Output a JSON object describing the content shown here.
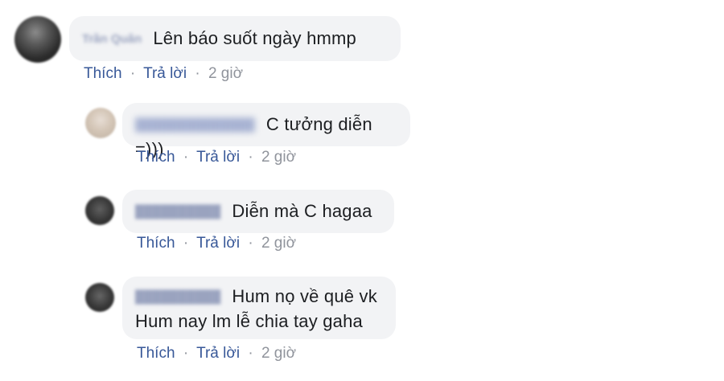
{
  "comments": [
    {
      "author": "Trần Quân",
      "text": "Lên báo suốt ngày hmmp",
      "like": "Thích",
      "reply": "Trả lời",
      "time": "2 giờ"
    },
    {
      "text": "C tưởng diễn =)))",
      "like": "Thích",
      "reply": "Trả lời",
      "time": "2 giờ"
    },
    {
      "text": "Diễn mà C hagaa",
      "like": "Thích",
      "reply": "Trả lời",
      "time": "2 giờ"
    },
    {
      "text_lines": [
        "Hum nọ về quê vk",
        "Hum nay lm lễ chia tay gaha"
      ],
      "like": "Thích",
      "reply": "Trả lời",
      "time": "2 giờ"
    }
  ],
  "separator": "·"
}
